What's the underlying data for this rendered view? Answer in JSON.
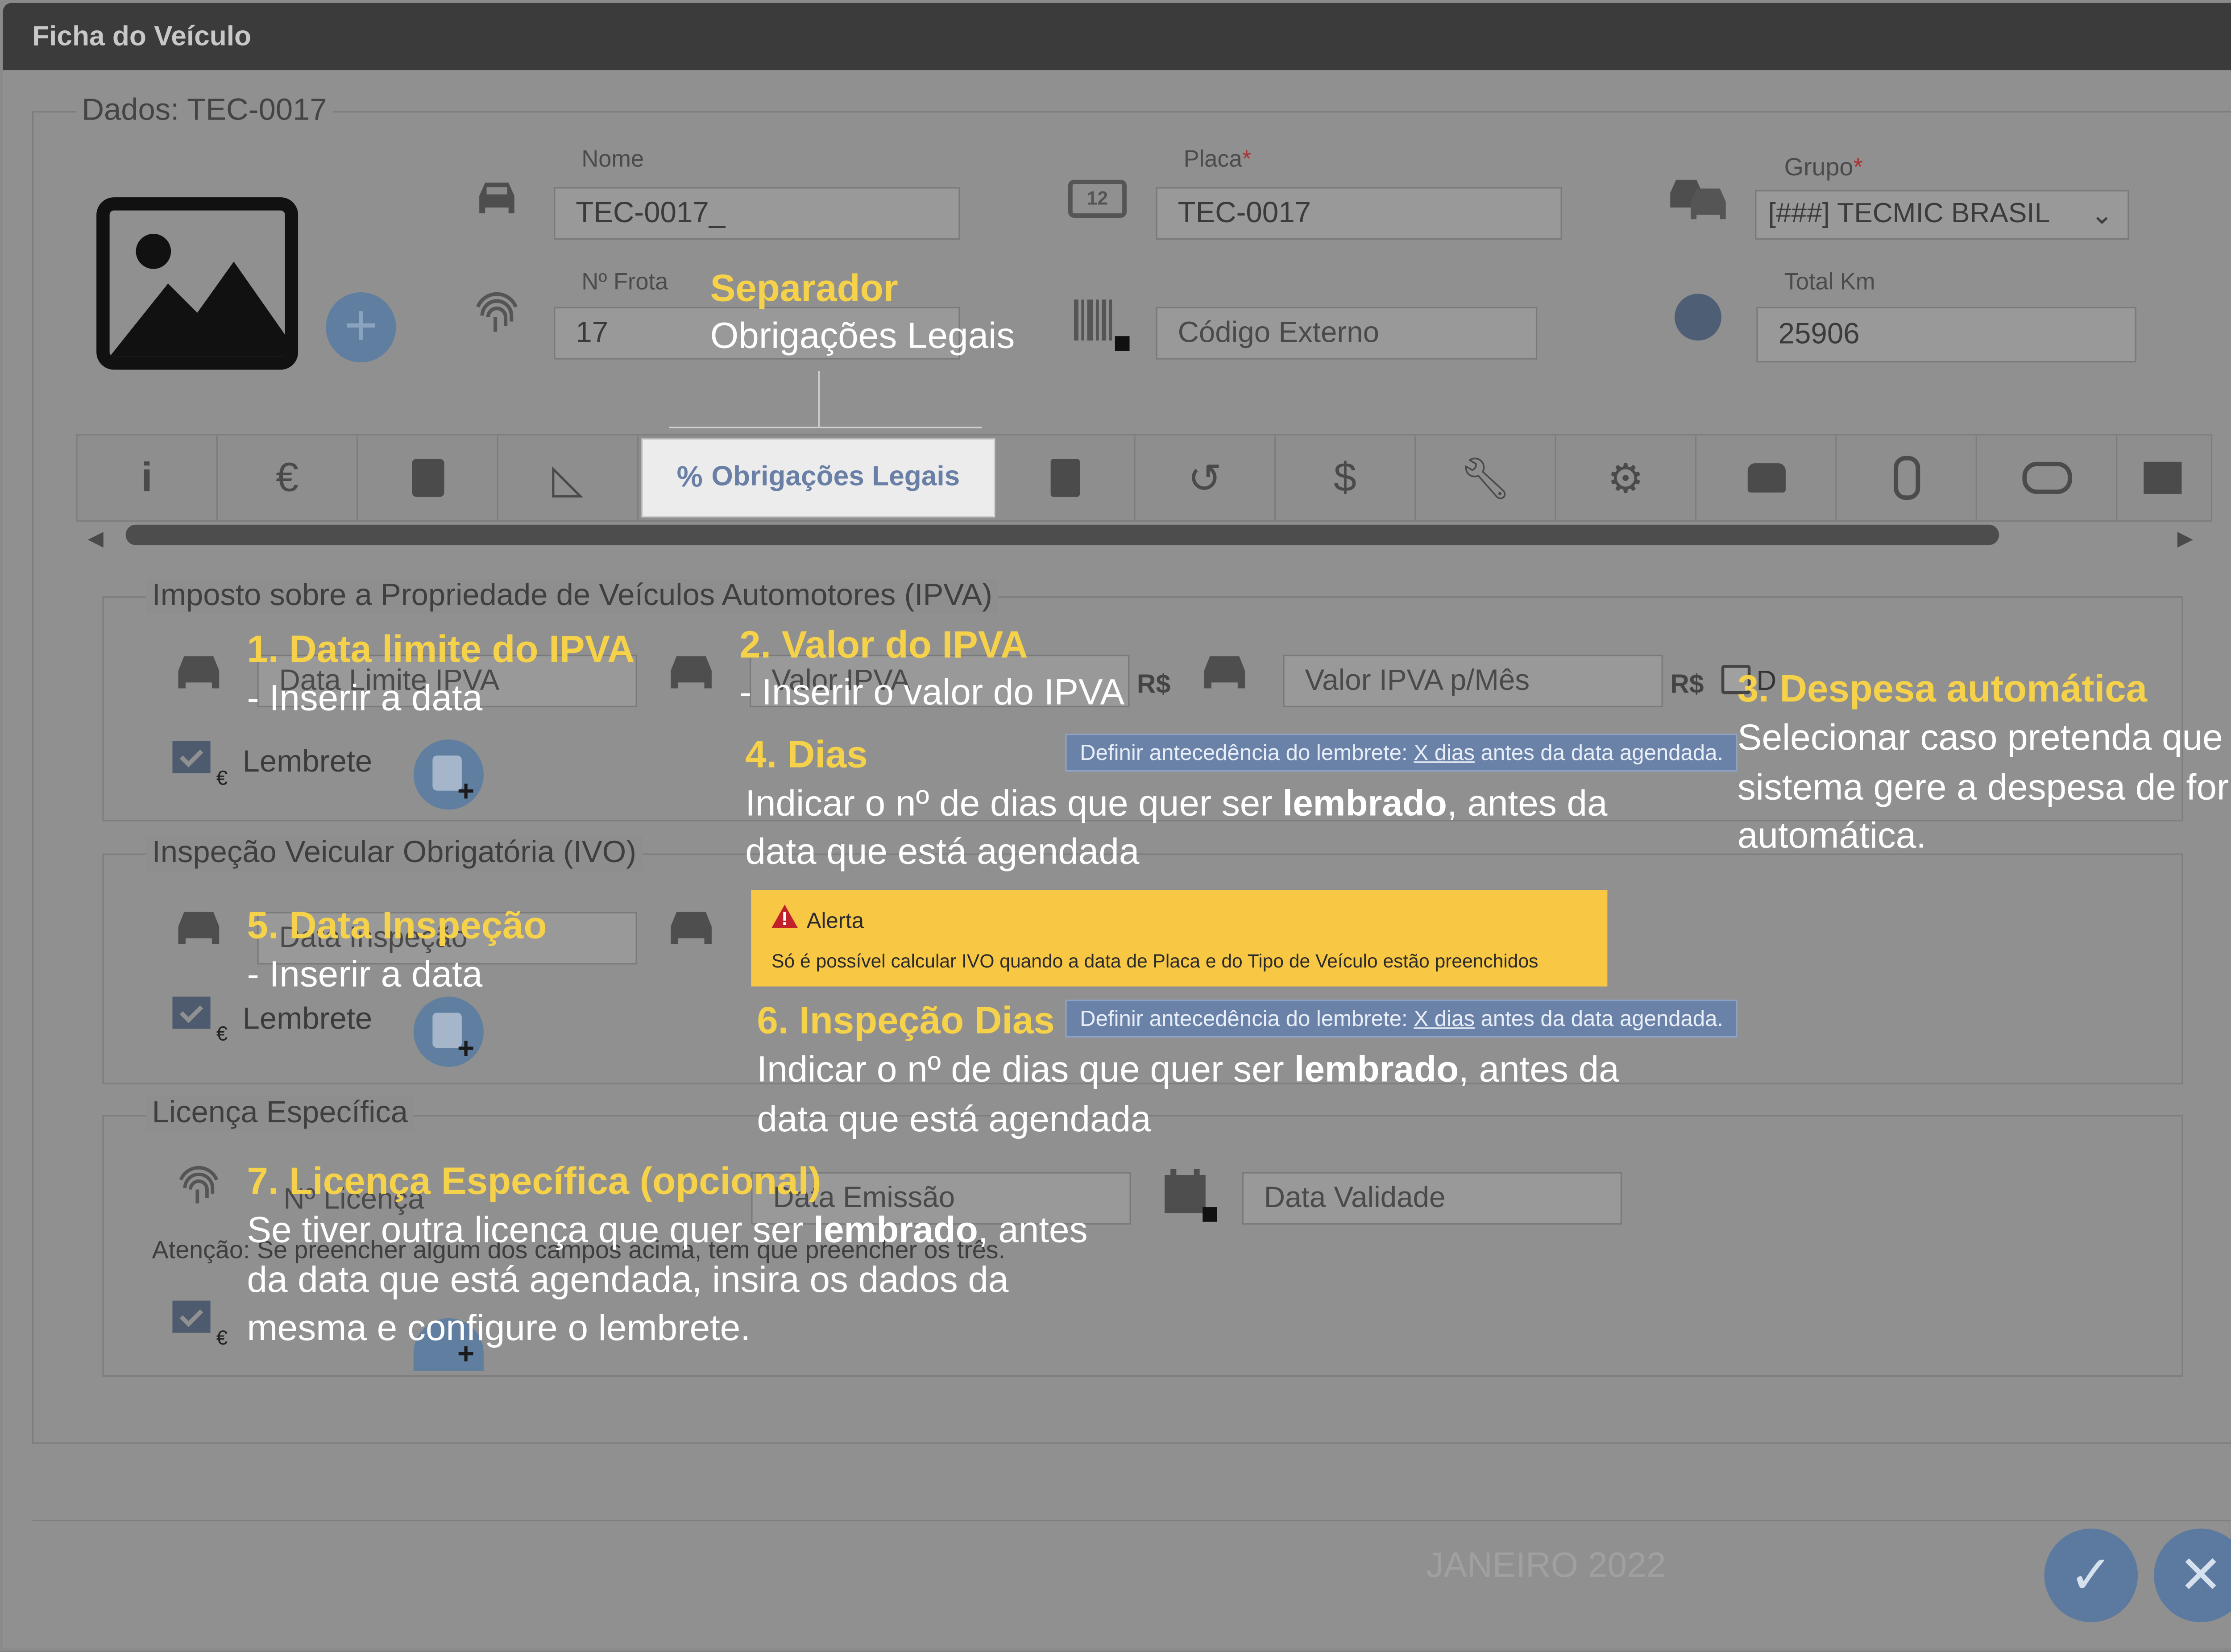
{
  "window": {
    "title": "Ficha do Veículo",
    "close": "✕"
  },
  "dados": {
    "label": "Dados: TEC-0017"
  },
  "fields": {
    "nome": {
      "label": "Nome",
      "value": "TEC-0017_"
    },
    "placa": {
      "label": "Placa",
      "req": "*",
      "value": "TEC-0017"
    },
    "grupo": {
      "label": "Grupo",
      "req": "*",
      "value": "[###] TECMIC BRASIL"
    },
    "frota": {
      "label": "Nº Frota",
      "value": "17"
    },
    "codigo_externo": {
      "placeholder": "Código Externo"
    },
    "total_km": {
      "label": "Total Km",
      "value": "25906"
    }
  },
  "tabs": {
    "active_label": "Obrigações Legais"
  },
  "ipva": {
    "title": "Imposto sobre a Propriedade de Veículos Automotores (IPVA)",
    "data_limite_placeholder": "Data Limite IPVA",
    "valor_placeholder": "Valor IPVA",
    "currency": "R$",
    "valor_mes_placeholder": "Valor IPVA p/Mês",
    "currency2": "R$",
    "despesa_checkbox_partial": "D",
    "lembrete": "Lembrete"
  },
  "ivo": {
    "title": "Inspeção Veicular Obrigatória (IVO)",
    "data_placeholder": "Data Inspeção",
    "lembrete": "Lembrete"
  },
  "licenca": {
    "title": "Licença Específica",
    "numero_placeholder": "Nº Licença",
    "emissao_placeholder": "Data Emissão",
    "validade_placeholder": "Data Validade",
    "atencao": "Atenção: Se preencher algum dos campos acima, tem que preencher os três."
  },
  "alert": {
    "title": "Alerta",
    "message": "Só é possível calcular IVO quando a data de Placa e do Tipo de Veículo estão preenchidos"
  },
  "info_bars": {
    "prefix": "Definir antecedência do lembrete: ",
    "link": "X dias",
    "suffix": " antes da data agendada."
  },
  "footer": {
    "watermark": "JANEIRO 2022",
    "confirm": "✓",
    "cancel": "✕"
  },
  "annotations": {
    "separador": {
      "heading": "Separador",
      "text": "Obrigações Legais"
    },
    "a1": {
      "heading": "1. Data limite do IPVA",
      "text": "- Inserir a data"
    },
    "a2": {
      "heading": "2. Valor do IPVA",
      "text": "- Inserir o valor do IPVA"
    },
    "a3": {
      "heading": "3. Despesa automática",
      "line1": "Selecionar caso pretenda que o",
      "line2": "sistema gere a despesa de forma",
      "line3": "automática."
    },
    "a4": {
      "heading": "4. Dias",
      "line1_pre": "Indicar o nº de dias que quer ser ",
      "line1_bold": "lembrado",
      "line1_post": ", antes da",
      "line2": "data que está agendada"
    },
    "a5": {
      "heading": "5. Data Inspeção",
      "text": "- Inserir a data"
    },
    "a6": {
      "heading": "6. Inspeção Dias",
      "line1_pre": "Indicar o nº de dias que quer ser ",
      "line1_bold": "lembrado",
      "line1_post": ", antes da",
      "line2": "data que está agendada"
    },
    "a7": {
      "heading": "7. Licença Específica (opcional)",
      "line1_pre": "Se tiver outra licença que quer ser ",
      "line1_bold": "lembrado",
      "line1_post": ", antes",
      "line2": "da data que está agendada, insira os dados da",
      "line3": "mesma e configure o lembrete."
    }
  },
  "colors": {
    "annotation_heading": "#f6d24a",
    "info_bar": "#6b82a8",
    "alert": "#f8c845",
    "accent": "#5c7aa0"
  }
}
